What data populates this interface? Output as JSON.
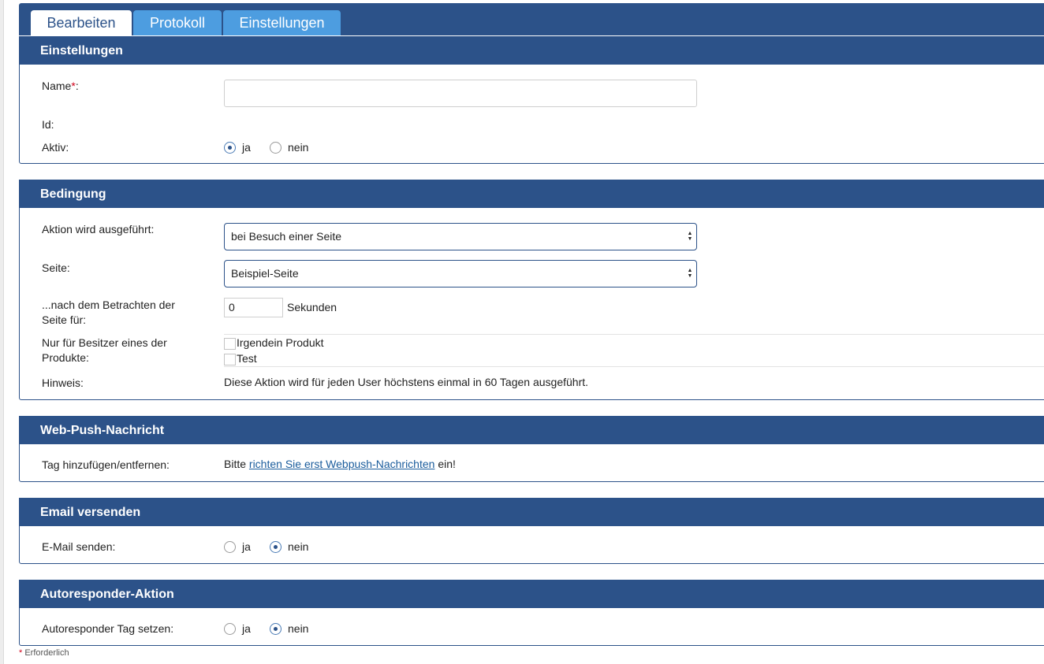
{
  "tabs": {
    "edit": "Bearbeiten",
    "log": "Protokoll",
    "settings": "Einstellungen"
  },
  "settings_panel": {
    "title": "Einstellungen",
    "name_label": "Name",
    "required_mark": "*",
    "name_suffix": ":",
    "name_value": "",
    "id_label": "Id:",
    "active_label": "Aktiv:",
    "active_yes": "ja",
    "active_no": "nein",
    "active_selected": "ja"
  },
  "condition_panel": {
    "title": "Bedingung",
    "action_label": "Aktion wird ausgeführt:",
    "action_selected": "bei Besuch einer Seite",
    "page_label": "Seite:",
    "page_selected": "Beispiel-Seite",
    "view_label_line1": "...nach dem Betrachten der",
    "view_label_line2": "Seite für:",
    "seconds_value": "0",
    "seconds_unit": "Sekunden",
    "owners_label_line1": "Nur für Besitzer eines der",
    "owners_label_line2": "Produkte:",
    "products": [
      "Irgendein Produkt",
      "Test"
    ],
    "hint_label": "Hinweis:",
    "hint_text": "Diese Aktion wird für jeden User höchstens einmal in 60 Tagen ausgeführt."
  },
  "webpush_panel": {
    "title": "Web-Push-Nachricht",
    "tag_label": "Tag hinzufügen/entfernen:",
    "text_before": "Bitte ",
    "link_text": "richten Sie erst Webpush-Nachrichten",
    "text_after": " ein!"
  },
  "email_panel": {
    "title": "Email versenden",
    "send_label": "E-Mail senden:",
    "yes": "ja",
    "no": "nein",
    "selected": "nein"
  },
  "autoresponder_panel": {
    "title": "Autoresponder-Aktion",
    "tag_label": "Autoresponder Tag setzen:",
    "yes": "ja",
    "no": "nein",
    "selected": "nein"
  },
  "footnote": {
    "mark": "*",
    "text": " Erforderlich"
  },
  "colors": {
    "header_blue": "#2c5289",
    "tab_light_blue": "#4d9de0",
    "required_red": "#d0021b",
    "link_blue": "#1a5c9c"
  },
  "icons": {
    "select_arrows": "updown-arrows-icon"
  }
}
